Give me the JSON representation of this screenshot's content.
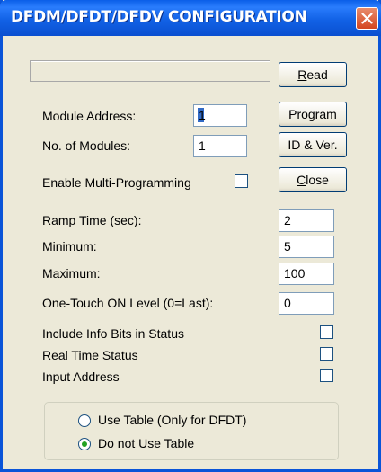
{
  "window": {
    "title": "DFDM/DFDT/DFDV CONFIGURATION"
  },
  "form": {
    "module_address_label": "Module Address:",
    "module_address_value": "1",
    "num_modules_label": "No. of Modules:",
    "num_modules_value": "1",
    "enable_multi_label": "Enable Multi-Programming",
    "ramp_time_label": "Ramp Time (sec):",
    "ramp_time_value": "2",
    "minimum_label": "Minimum:",
    "minimum_value": "5",
    "maximum_label": "Maximum:",
    "maximum_value": "100",
    "one_touch_label": "One-Touch ON Level (0=Last):",
    "one_touch_value": "0",
    "include_info_label": "Include Info Bits in Status",
    "real_time_label": "Real Time Status",
    "input_address_label": "Input Address"
  },
  "buttons": {
    "read_u": "R",
    "read_rest": "ead",
    "program_u": "P",
    "program_rest": "rogram",
    "id_ver": "ID & Ver.",
    "close_u": "C",
    "close_rest": "lose"
  },
  "table_options": {
    "use_table": "Use Table (Only for DFDT)",
    "no_table": "Do not Use Table",
    "selected": "no_table"
  },
  "icons": {
    "close": "close-x-icon"
  },
  "colors": {
    "titlebar": "#0a5ee8",
    "dialog_bg": "#ece9d8",
    "close_btn": "#d4451f",
    "radio_selected": "#21a121"
  }
}
